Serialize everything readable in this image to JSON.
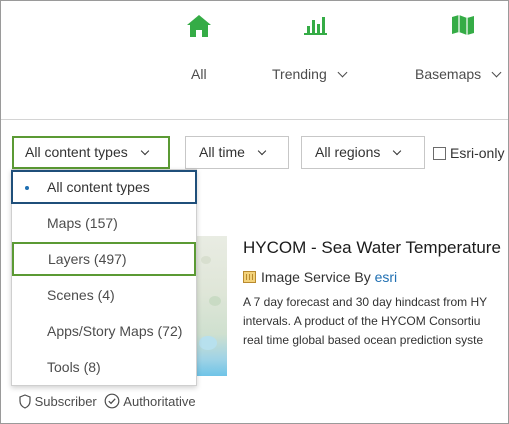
{
  "nav": {
    "all_label": "All",
    "trending_label": "Trending",
    "basemaps_label": "Basemaps",
    "icon_color": "#35ac46"
  },
  "filters": {
    "content_types": "All content types",
    "time": "All time",
    "regions": "All regions",
    "esri_only": "Esri-only"
  },
  "dropdown": {
    "items": [
      "All content types",
      "Maps (157)",
      "Layers (497)",
      "Scenes (4)",
      "Apps/Story Maps (72)",
      "Tools (8)"
    ],
    "selected_index": 0,
    "highlighted_index": 2
  },
  "card": {
    "title": "HYCOM - Sea Water Temperature",
    "type_label": "Image Service By",
    "owner": "esri",
    "description_lines": [
      "A 7 day forecast and 30 day hindcast from HY",
      "intervals. A product of the HYCOM Consortiu",
      "real time global based ocean prediction syste"
    ]
  },
  "footer": {
    "subscriber": "Subscriber",
    "authoritative": "Authoritative"
  },
  "colors": {
    "highlight_green": "#5b9a34",
    "selected_border": "#1f4f7a",
    "link_blue": "#1f6fb2"
  }
}
